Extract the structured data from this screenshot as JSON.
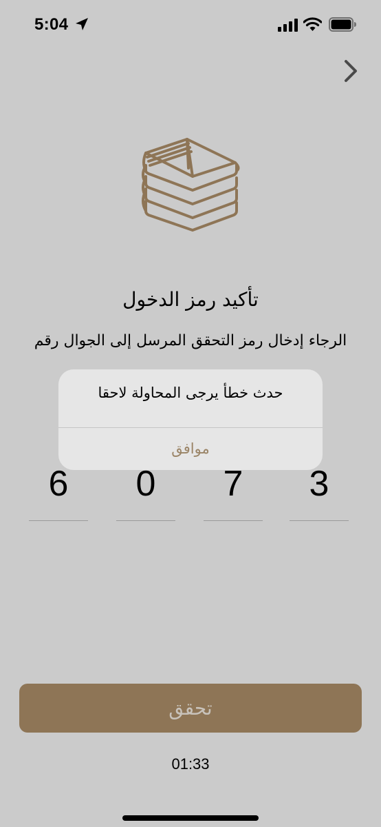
{
  "status_bar": {
    "time": "5:04",
    "icons": [
      "location-arrow-icon",
      "cellular-signal-icon",
      "wifi-icon",
      "battery-icon"
    ]
  },
  "nav": {
    "back_icon": "chevron-right-icon"
  },
  "logo_icon": "stacked-books-logo",
  "screen": {
    "title": "تأكيد رمز الدخول",
    "subtitle": "الرجاء إدخال رمز التحقق المرسل إلى الجوال رقم"
  },
  "otp": {
    "digits": [
      "6",
      "0",
      "7",
      "3"
    ]
  },
  "verify_button": {
    "label": "تحقق"
  },
  "timer": {
    "value": "01:33"
  },
  "alert": {
    "message": "حدث خطأ يرجى المحاولة لاحقا",
    "ok_label": "موافق"
  },
  "colors": {
    "background": "#cbcbcb",
    "brand_gold": "#8e7556",
    "alert_background": "#e6e6e6",
    "alert_button_text": "#9a8466"
  }
}
